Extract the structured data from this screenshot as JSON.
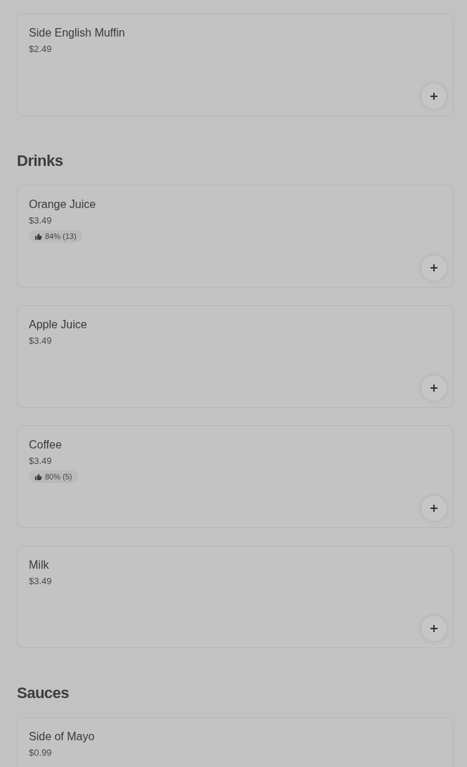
{
  "sections": [
    {
      "items": [
        {
          "name": "Side English Muffin",
          "price": "$2.49",
          "add_button": true
        }
      ]
    },
    {
      "title": "Drinks",
      "items": [
        {
          "name": "Orange Juice",
          "price": "$3.49",
          "rating": "84% (13)",
          "add_button": true
        },
        {
          "name": "Apple Juice",
          "price": "$3.49",
          "add_button": true
        },
        {
          "name": "Coffee",
          "price": "$3.49",
          "rating": "80% (5)",
          "add_button": true
        },
        {
          "name": "Milk",
          "price": "$3.49",
          "add_button": true
        }
      ]
    },
    {
      "title": "Sauces",
      "items": [
        {
          "name": "Side of Mayo",
          "price": "$0.99"
        }
      ]
    }
  ]
}
